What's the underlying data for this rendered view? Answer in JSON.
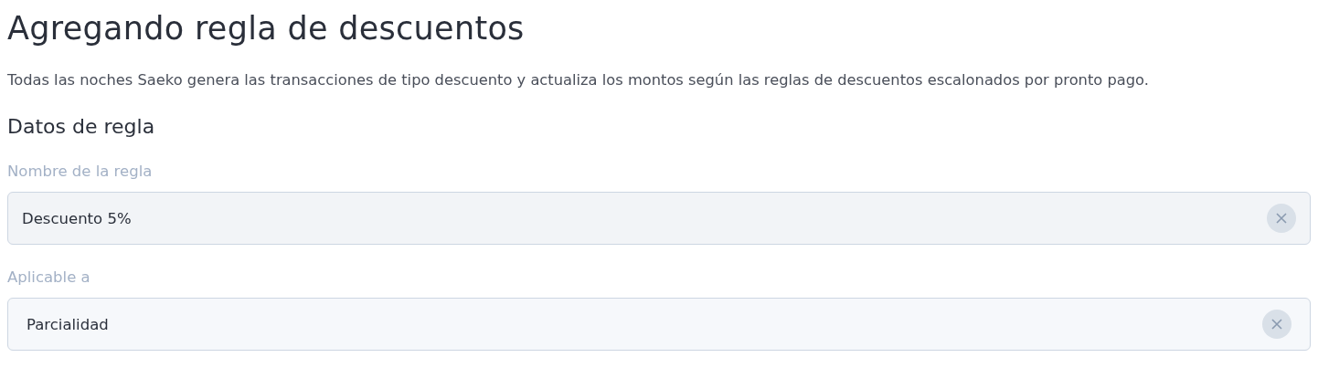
{
  "title": "Agregando regla de descuentos",
  "description": "Todas las noches Saeko genera las transacciones de tipo descuento y actualiza los montos según las reglas de descuentos escalonados por pronto pago.",
  "section": "Datos de regla",
  "fields": [
    {
      "kind": "text",
      "label": "Nombre de la regla",
      "value": "Descuento 5%"
    },
    {
      "kind": "select",
      "label": "Aplicable a",
      "value": "Parcialidad"
    }
  ]
}
